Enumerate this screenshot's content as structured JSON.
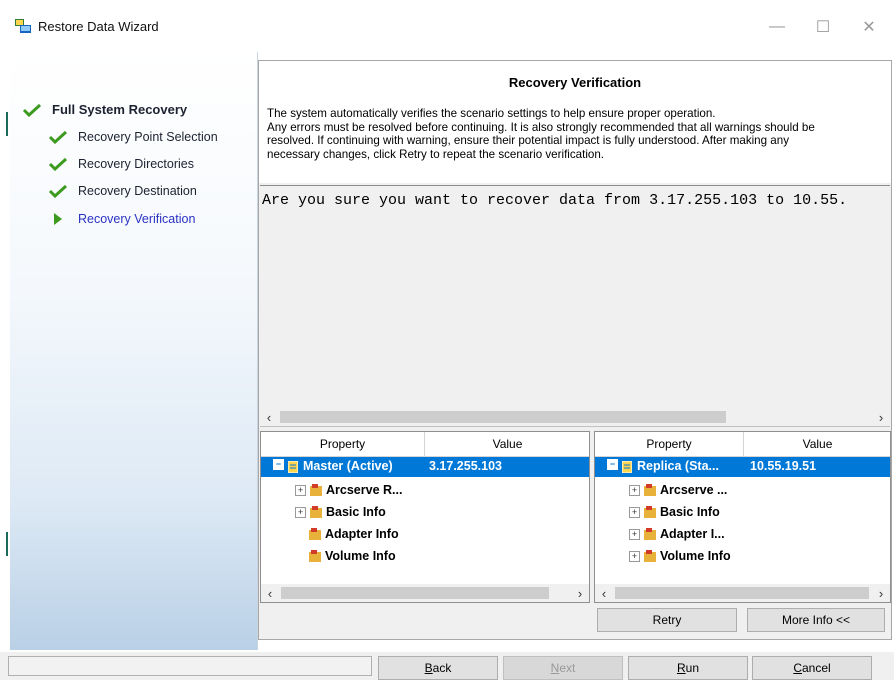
{
  "window": {
    "title": "Restore Data Wizard",
    "icon": "restore-wizard-icon",
    "controls": {
      "minimize": "—",
      "maximize": "☐",
      "close": "✕"
    }
  },
  "sidebar": {
    "steps": [
      {
        "label": "Full System Recovery",
        "state": "done",
        "icon": "check-icon",
        "level": "main"
      },
      {
        "label": "Recovery Point Selection",
        "state": "done",
        "icon": "check-icon",
        "level": "sub"
      },
      {
        "label": "Recovery Directories",
        "state": "done",
        "icon": "check-icon",
        "level": "sub"
      },
      {
        "label": "Recovery Destination",
        "state": "done",
        "icon": "check-icon",
        "level": "sub"
      },
      {
        "label": "Recovery Verification",
        "state": "current",
        "icon": "play-arrow-icon",
        "level": "sub"
      }
    ]
  },
  "header": {
    "title": "Recovery Verification",
    "description": "The system automatically verifies the scenario settings to help ensure proper operation.\nAny errors must be resolved before continuing. It is also strongly recommended that all warnings should be\nresolved. If continuing with warning, ensure their potential impact is fully understood. After making any\nnecessary changes, click Retry to repeat the scenario verification."
  },
  "message": {
    "text": "Are you sure you want to recover data from 3.17.255.103 to 10.55."
  },
  "master_grid": {
    "columns": [
      "Property",
      "Value"
    ],
    "root": {
      "label": "Master (Active)",
      "value": "3.17.255.103"
    },
    "children": [
      {
        "label": "Arcserve R...",
        "expandable": true
      },
      {
        "label": "Basic Info",
        "expandable": true
      },
      {
        "label": "Adapter Info",
        "expandable": false
      },
      {
        "label": "Volume Info",
        "expandable": false
      }
    ]
  },
  "replica_grid": {
    "columns": [
      "Property",
      "Value"
    ],
    "root": {
      "label": "Replica (Sta...",
      "value": "10.55.19.51"
    },
    "children": [
      {
        "label": "Arcserve ...",
        "expandable": true
      },
      {
        "label": "Basic Info",
        "expandable": true
      },
      {
        "label": "Adapter I...",
        "expandable": true
      },
      {
        "label": "Volume Info",
        "expandable": true
      }
    ]
  },
  "panel_buttons": {
    "retry": "Retry",
    "more_info": "More Info <<"
  },
  "footer": {
    "back": {
      "mnemonic": "B",
      "rest": "ack"
    },
    "next": {
      "mnemonic": "N",
      "rest": "ext",
      "disabled": true
    },
    "run": {
      "mnemonic": "R",
      "rest": "un"
    },
    "cancel": {
      "mnemonic": "C",
      "rest": "ancel"
    }
  },
  "colors": {
    "selection": "#0078d7",
    "current_step": "#2a31c4",
    "check": "#3c9a1e",
    "folder": "#e8b23a"
  }
}
